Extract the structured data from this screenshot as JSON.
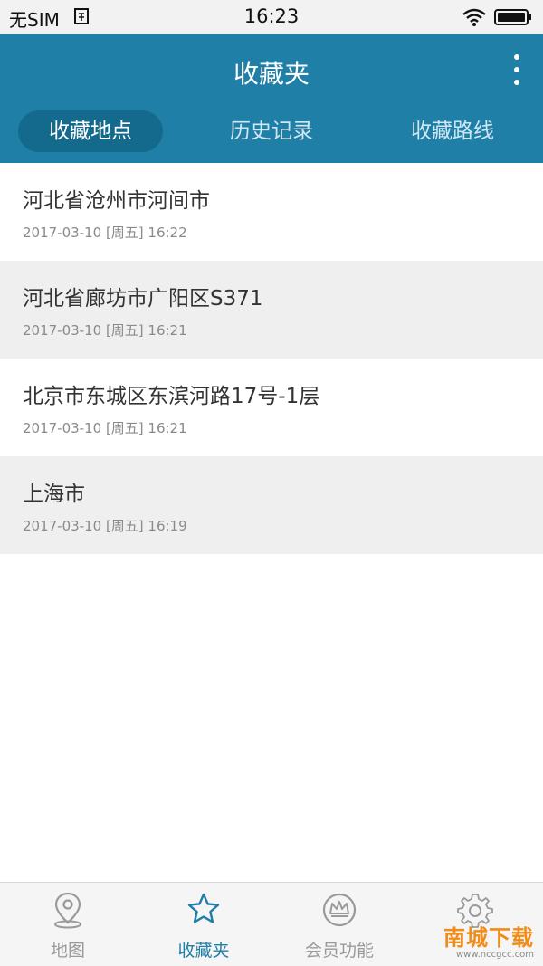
{
  "status_bar": {
    "carrier": "无SIM",
    "time": "16:23",
    "icons": [
      "sim-card-icon",
      "wifi-icon",
      "battery-icon"
    ]
  },
  "header": {
    "title": "收藏夹",
    "menu_icon": "more-vertical-icon",
    "tabs": [
      {
        "label": "收藏地点",
        "active": true
      },
      {
        "label": "历史记录",
        "active": false
      },
      {
        "label": "收藏路线",
        "active": false
      }
    ]
  },
  "list": {
    "items": [
      {
        "title": "河北省沧州市河间市",
        "date": "2017-03-10 [周五] 16:22"
      },
      {
        "title": "河北省廊坊市广阳区S371",
        "date": "2017-03-10 [周五] 16:21"
      },
      {
        "title": "北京市东城区东滨河路17号-1层",
        "date": "2017-03-10 [周五] 16:21"
      },
      {
        "title": "上海市",
        "date": "2017-03-10 [周五] 16:19"
      }
    ]
  },
  "bottom_nav": {
    "items": [
      {
        "label": "地图",
        "icon": "map-pin-icon",
        "active": false
      },
      {
        "label": "收藏夹",
        "icon": "star-icon",
        "active": true
      },
      {
        "label": "会员功能",
        "icon": "crown-icon",
        "active": false
      },
      {
        "label": "",
        "icon": "gear-icon",
        "active": false
      }
    ]
  },
  "watermark": {
    "main": "南城下载",
    "sub": "www.nccgcc.com"
  },
  "colors": {
    "header_bg": "#1f7fa6",
    "active_tab_bg": "#146a8c",
    "active_nav": "#1f7fa6",
    "inactive_nav": "#9a9a9a",
    "alt_row": "#efefef"
  }
}
